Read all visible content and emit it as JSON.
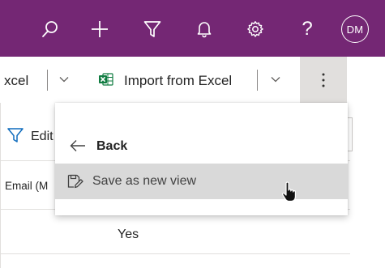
{
  "header": {
    "background": "#742774",
    "icons": [
      "search-icon",
      "plus-icon",
      "filter-icon",
      "bell-icon",
      "gear-icon",
      "help-icon"
    ],
    "avatar_initials": "DM"
  },
  "commandbar": {
    "export_partial_label": "xcel",
    "import_label": "Import from Excel",
    "more_icon": "more-vertical-icon"
  },
  "grid": {
    "edit_partial_label": "Edit",
    "column_header_partial": "Email (M",
    "cell_value": "Yes"
  },
  "menu": {
    "back_label": "Back",
    "items": [
      {
        "label": "Save as new view",
        "icon": "save-view-icon"
      }
    ]
  }
}
